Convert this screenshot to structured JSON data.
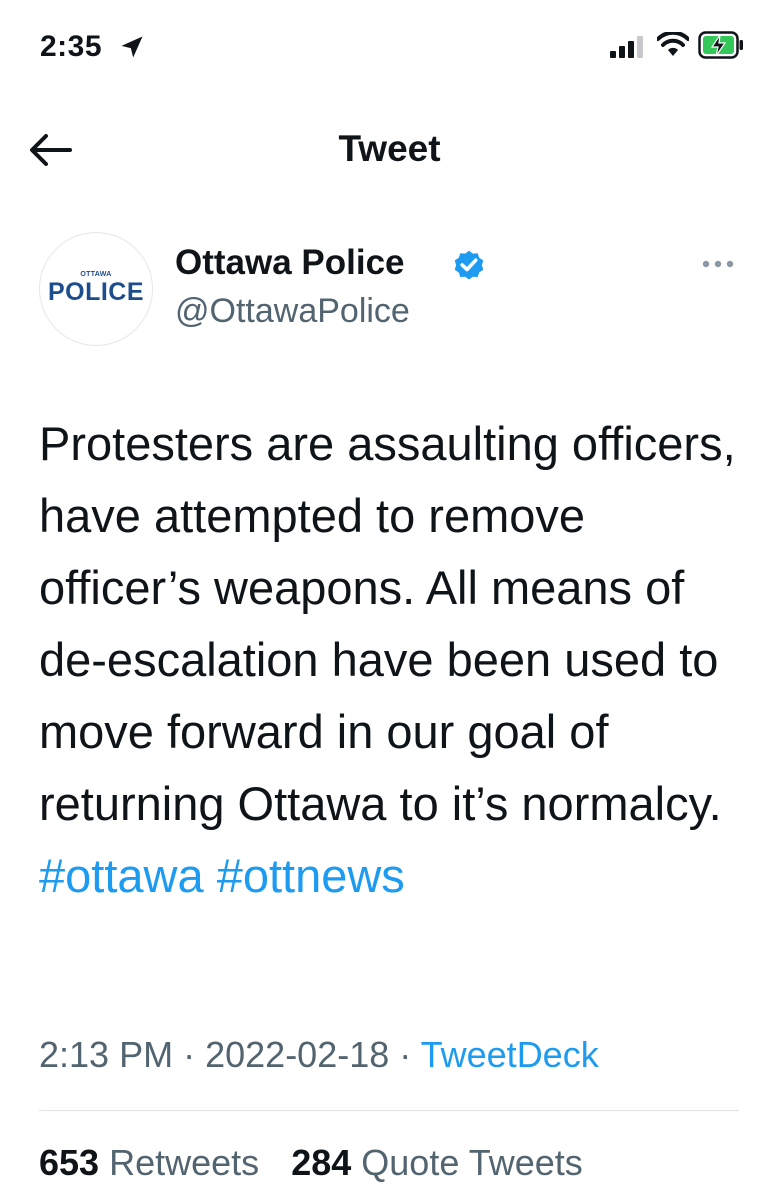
{
  "status_bar": {
    "time": "2:35",
    "icons": [
      "location-arrow-icon",
      "cellular-signal-icon",
      "wifi-icon",
      "battery-charging-icon"
    ],
    "battery_color": "#34c759"
  },
  "nav": {
    "title": "Tweet",
    "back_icon": "arrow-left-icon"
  },
  "author": {
    "avatar_small_text": "OTTAWA",
    "avatar_text": "POLICE",
    "display_name": "Ottawa Police",
    "handle": "@OttawaPolice",
    "verified": true,
    "more_icon": "more-dots-icon"
  },
  "tweet": {
    "text": "Protesters are assaulting officers, have attempted to remove officer’s weapons. All means of de-escalation have been used to move forward in our goal of returning Ottawa to it’s normalcy.",
    "hashtags": [
      "#ottawa",
      "#ottnews"
    ]
  },
  "meta": {
    "time": "2:13 PM",
    "separator": "·",
    "date": "2022-02-18",
    "source": "TweetDeck"
  },
  "stats": {
    "retweets_count": "653",
    "retweets_label": "Retweets",
    "quotes_count": "284",
    "quotes_label": "Quote Tweets"
  },
  "colors": {
    "link": "#1d9bf0",
    "secondary_text": "#536471",
    "primary_text": "#0f1419",
    "police_blue": "#1d4d8c"
  }
}
